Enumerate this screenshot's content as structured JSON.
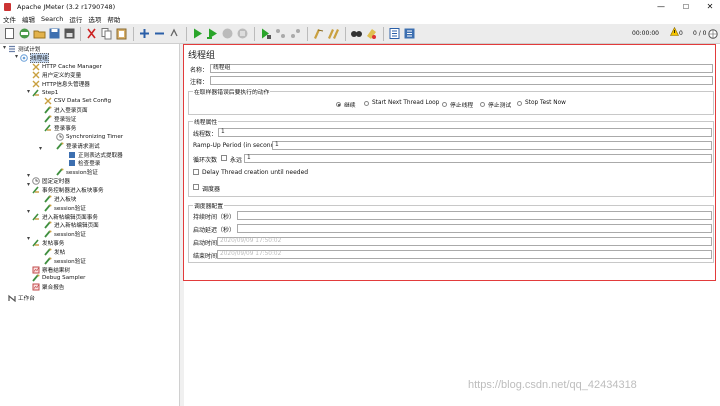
{
  "window": {
    "title": "Apache JMeter (3.2 r1790748)",
    "minimize": "—",
    "maximize": "☐",
    "close": "✕"
  },
  "menu": [
    "文件",
    "编辑",
    "Search",
    "运行",
    "选项",
    "帮助"
  ],
  "toolbar": {
    "timer": "00:00:00",
    "warnings": "0",
    "threads": "0 / 0"
  },
  "tree": [
    {
      "label": "测试计划",
      "icon": "test-plan-icon"
    },
    {
      "label": "线程组",
      "icon": "thread-group-icon",
      "selected": true
    },
    {
      "label": "HTTP Cache Manager",
      "icon": "config-icon"
    },
    {
      "label": "用户定义的变量",
      "icon": "config-icon"
    },
    {
      "label": "HTTP信息头管理器",
      "icon": "config-icon"
    },
    {
      "label": "Step1",
      "icon": "controller-icon"
    },
    {
      "label": "CSV Data Set Config",
      "icon": "config-icon"
    },
    {
      "label": "进入登录页面",
      "icon": "sampler-icon"
    },
    {
      "label": "登录验证",
      "icon": "sampler-icon"
    },
    {
      "label": "登录事务",
      "icon": "controller-icon"
    },
    {
      "label": "Synchronizing Timer",
      "icon": "timer-icon"
    },
    {
      "label": "登录请求测试",
      "icon": "sampler-icon"
    },
    {
      "label": "正则表达式提取器",
      "icon": "extractor-icon"
    },
    {
      "label": "检查登录",
      "icon": "assertion-icon"
    },
    {
      "label": "session验证",
      "icon": "sampler-icon"
    },
    {
      "label": "固定定时器",
      "icon": "timer-icon"
    },
    {
      "label": "事务控制器进入板块事务",
      "icon": "controller-icon"
    },
    {
      "label": "进入板块",
      "icon": "sampler-icon"
    },
    {
      "label": "session验证",
      "icon": "sampler-icon"
    },
    {
      "label": "进入新帖编辑页面事务",
      "icon": "controller-icon"
    },
    {
      "label": "进入新帖编辑页面",
      "icon": "sampler-icon"
    },
    {
      "label": "session验证",
      "icon": "sampler-icon"
    },
    {
      "label": "发帖事务",
      "icon": "controller-icon"
    },
    {
      "label": "发帖",
      "icon": "sampler-icon"
    },
    {
      "label": "session验证",
      "icon": "sampler-icon"
    },
    {
      "label": "察看结果树",
      "icon": "listener-icon"
    },
    {
      "label": "Debug Sampler",
      "icon": "sampler-icon"
    },
    {
      "label": "聚合报告",
      "icon": "listener-icon"
    },
    {
      "label": "工作台",
      "icon": "workbench-icon"
    }
  ],
  "editor": {
    "heading": "线程组",
    "name_label": "名称：",
    "name_value": "线程组",
    "comment_label": "注释：",
    "comment_value": "",
    "error_action": {
      "legend": "在取样器错误后要执行的动作",
      "options": [
        "继续",
        "Start Next Thread Loop",
        "停止线程",
        "停止测试",
        "Stop Test Now"
      ],
      "selected": 0
    },
    "thread_props": {
      "legend": "线程属性",
      "threads_label": "线程数：",
      "threads_value": "1",
      "rampup_label": "Ramp-Up Period (in seconds):",
      "rampup_value": "1",
      "loop_label": "循环次数",
      "forever_label": "永远",
      "loop_value": "1",
      "delay_label": "Delay Thread creation until needed",
      "scheduler_label": "调度器"
    },
    "scheduler": {
      "legend": "调度器配置",
      "duration_label": "持续时间（秒）",
      "duration_value": "",
      "delay_label": "启动延迟（秒）",
      "delay_value": "",
      "start_label": "启动时间",
      "start_value": "2020/09/09 17:50:02",
      "end_label": "结束时间",
      "end_value": "2020/09/09 17:50:02"
    }
  },
  "watermark": "https://blog.csdn.net/qq_42434318"
}
